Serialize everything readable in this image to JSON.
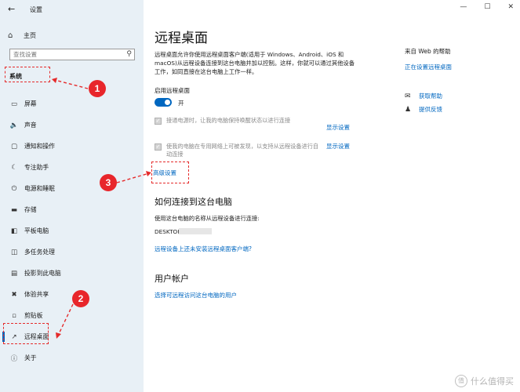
{
  "window": {
    "title": "设置"
  },
  "sidebar": {
    "home_label": "主页",
    "search_placeholder": "查找设置",
    "section_title": "系统",
    "items": [
      {
        "label": "屏幕",
        "icon": "monitor-icon"
      },
      {
        "label": "声音",
        "icon": "speaker-icon"
      },
      {
        "label": "通知和操作",
        "icon": "notification-icon"
      },
      {
        "label": "专注助手",
        "icon": "moon-icon"
      },
      {
        "label": "电源和睡眠",
        "icon": "power-icon"
      },
      {
        "label": "存储",
        "icon": "storage-icon"
      },
      {
        "label": "平板电脑",
        "icon": "tablet-icon"
      },
      {
        "label": "多任务处理",
        "icon": "multitask-icon"
      },
      {
        "label": "投影到此电脑",
        "icon": "project-icon"
      },
      {
        "label": "体验共享",
        "icon": "share-icon"
      },
      {
        "label": "剪贴板",
        "icon": "clipboard-icon"
      },
      {
        "label": "远程桌面",
        "icon": "remote-desktop-icon",
        "active": true
      },
      {
        "label": "关于",
        "icon": "info-icon"
      }
    ]
  },
  "main": {
    "title": "远程桌面",
    "description": "远程桌面允许你使用远程桌面客户端(适用于 Windows、Android、iOS 和 macOS)从远程设备连接到这台电脑并加以控制。这样，你就可以通过其他设备工作，如同直接在这台电脑上工作一样。",
    "enable_label": "启用远程桌面",
    "toggle_state": "开",
    "option1_text": "接通电源时，让我的电脑保持唤醒状态以进行连接",
    "option1_link": "显示设置",
    "option2_text": "使我的电脑在专用网络上可被发现，以支持从远程设备进行自动连接",
    "option2_link": "显示设置",
    "advanced_link": "高级设置",
    "connect_heading": "如何连接到这台电脑",
    "connect_text": "使用这台电脑的名称从远程设备进行连接:",
    "pc_name": "DESKTOP",
    "no_client_link": "远程设备上还未安装远程桌面客户端?",
    "accounts_heading": "用户帐户",
    "accounts_link": "选择可远程访问这台电脑的用户"
  },
  "help": {
    "title": "来自 Web 的帮助",
    "link": "正在设置远程桌面",
    "get_help": "获取帮助",
    "feedback": "提供反馈"
  },
  "annotations": {
    "badge1": "1",
    "badge2": "2",
    "badge3": "3",
    "color": "#e52b2b"
  },
  "watermark": {
    "text": "什么值得买",
    "logo": "值"
  }
}
